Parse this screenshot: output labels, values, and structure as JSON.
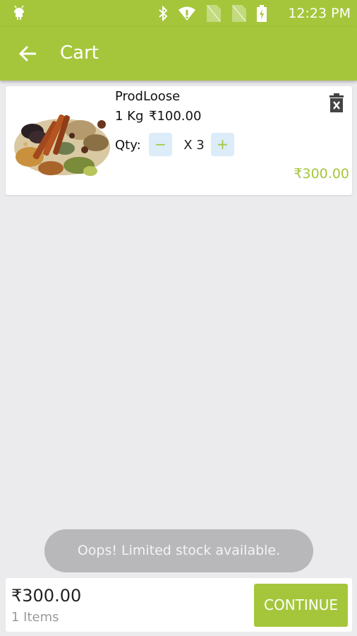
{
  "status_bar": {
    "time": "12:23 PM",
    "icons": [
      "android-icon",
      "bluetooth-icon",
      "wifi-icon",
      "no-sim-icon",
      "no-sim-icon",
      "battery-charging-icon"
    ]
  },
  "app_bar": {
    "back_icon": "back-arrow-icon",
    "title": "Cart"
  },
  "cart": {
    "items": [
      {
        "name": "ProdLoose",
        "unit": "1 Kg",
        "price": "₹100.00",
        "qty_label": "Qty:",
        "minus_label": "−",
        "quantity": "X 3",
        "plus_label": "+",
        "total": "₹300.00",
        "image": "spices-image",
        "delete_icon": "trash-icon"
      }
    ]
  },
  "toast": {
    "message": "Oops! Limited stock available."
  },
  "footer": {
    "grand_total": "₹300.00",
    "item_count": "1 Items",
    "continue_label": "CONTINUE"
  },
  "colors": {
    "primary": "#a5c63b",
    "background": "#ebebed",
    "qty_button": "#dcecf8",
    "toast": "#b8b8ba"
  }
}
